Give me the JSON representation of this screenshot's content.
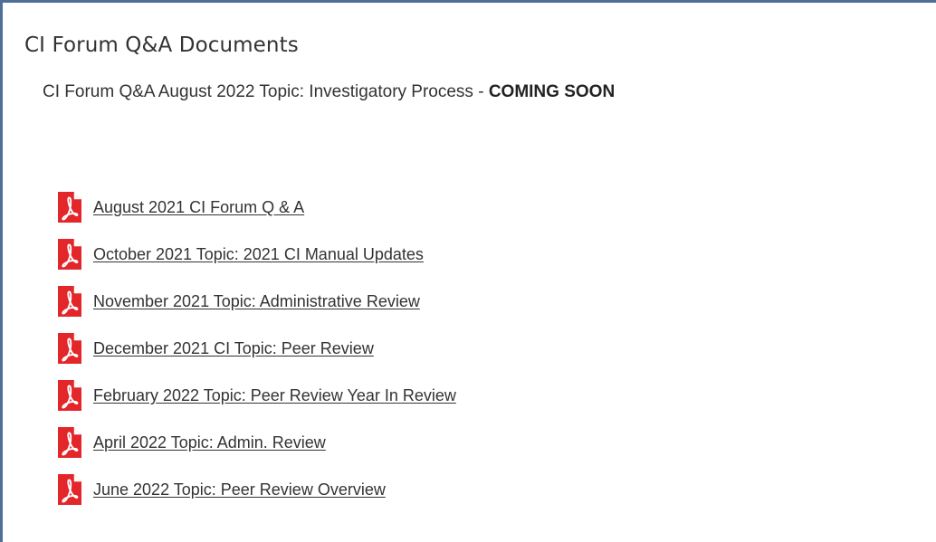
{
  "page": {
    "title": "CI Forum Q&A Documents",
    "subtitle_text": "CI Forum Q&A August 2022 Topic: Investigatory Process - ",
    "subtitle_status": "COMING SOON"
  },
  "documents": [
    {
      "label": "August 2021 CI Forum Q & A",
      "icon": "pdf-icon"
    },
    {
      "label": "October 2021 Topic: 2021 CI Manual Updates",
      "icon": "pdf-icon"
    },
    {
      "label": "November 2021 Topic: Administrative Review",
      "icon": "pdf-icon"
    },
    {
      "label": "December 2021 CI Topic: Peer Review",
      "icon": "pdf-icon"
    },
    {
      "label": "February 2022 Topic: Peer Review Year In Review",
      "icon": "pdf-icon"
    },
    {
      "label": "April 2022 Topic: Admin. Review",
      "icon": "pdf-icon"
    },
    {
      "label": "June 2022 Topic: Peer Review Overview",
      "icon": "pdf-icon"
    }
  ],
  "colors": {
    "pdf_icon": "#e3262a",
    "frame_border": "#4f6f96",
    "text": "#333333"
  }
}
